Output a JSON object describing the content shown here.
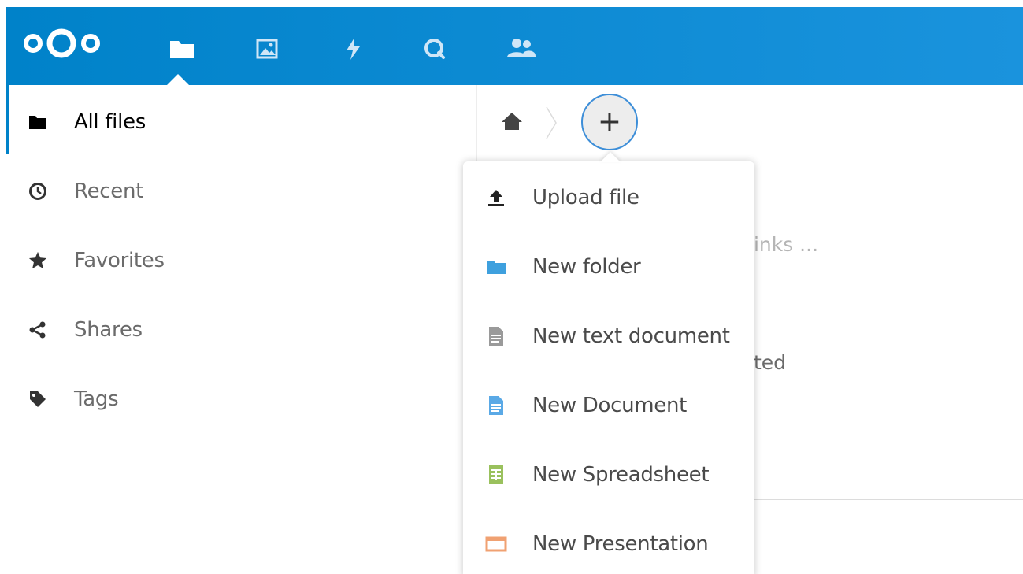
{
  "header": {
    "brand_color": "#0082c9",
    "nav_icons": [
      "files-icon",
      "photos-icon",
      "activity-icon",
      "search-icon",
      "contacts-icon"
    ],
    "active_app": "files"
  },
  "sidebar": {
    "items": [
      {
        "label": "All files",
        "icon": "folder-icon",
        "active": true
      },
      {
        "label": "Recent",
        "icon": "clock-icon",
        "active": false
      },
      {
        "label": "Favorites",
        "icon": "star-icon",
        "active": false
      },
      {
        "label": "Shares",
        "icon": "share-icon",
        "active": false
      },
      {
        "label": "Tags",
        "icon": "tag-icon",
        "active": false
      }
    ]
  },
  "breadcrumb": {
    "home_icon": "home-icon",
    "add_label": "+"
  },
  "background": {
    "text1": "links ...",
    "text2": "ited"
  },
  "new_menu": {
    "items": [
      {
        "label": "Upload file",
        "icon": "upload-icon",
        "color": "#222222"
      },
      {
        "label": "New folder",
        "icon": "folder-icon",
        "color": "#3ea0de"
      },
      {
        "label": "New text document",
        "icon": "text-file-icon",
        "color": "#9a9a9a"
      },
      {
        "label": "New Document",
        "icon": "document-icon",
        "color": "#5aa9e6"
      },
      {
        "label": "New Spreadsheet",
        "icon": "spreadsheet-icon",
        "color": "#9ac15d"
      },
      {
        "label": "New Presentation",
        "icon": "presentation-icon",
        "color": "#f0a172"
      }
    ]
  }
}
